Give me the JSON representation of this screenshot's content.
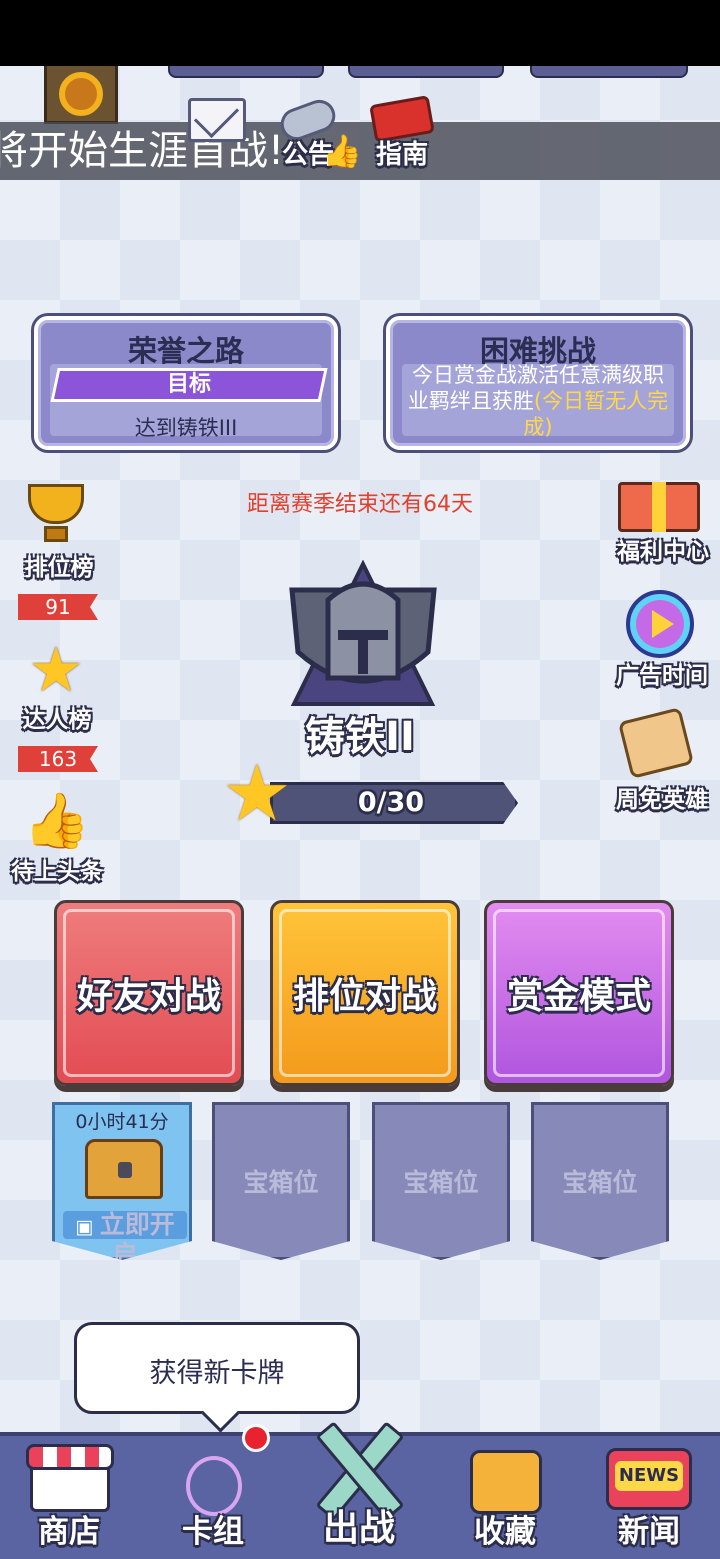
{
  "marquee": {
    "text": "将开始生涯首战!"
  },
  "top_icons": {
    "notice_label": "公告",
    "guide_label": "指南"
  },
  "honor_road": {
    "title": "荣誉之路",
    "goal_label": "目标",
    "requirement": "达到铸铁III"
  },
  "hard_challenge": {
    "title": "困难挑战",
    "desc": "今日赏金战激活任意满级职业羁绊且获胜",
    "status": "(今日暂无人完成)"
  },
  "season": {
    "countdown": "距离赛季结束还有64天"
  },
  "left_side": {
    "leaderboard": {
      "label": "排位榜",
      "badge": "91"
    },
    "experts": {
      "label": "达人榜",
      "badge": "163"
    },
    "headline": {
      "label": "待上头条"
    }
  },
  "right_side": {
    "welfare": "福利中心",
    "ad_time": "广告时间",
    "free_heroes": "周免英雄"
  },
  "rank": {
    "name": "铸铁II",
    "stars": "0/30"
  },
  "modes": {
    "friend": "好友对战",
    "ranked": "排位对战",
    "bounty": "赏金模式"
  },
  "chests": {
    "active": {
      "timer": "0小时41分",
      "action": "立即开启"
    },
    "empty_label": "宝箱位"
  },
  "tooltip": {
    "text": "获得新卡牌"
  },
  "nav": {
    "shop": "商店",
    "deck": "卡组",
    "battle": "出战",
    "collect": "收藏",
    "news": "新闻",
    "news_badge": "NEWS"
  },
  "colors": {
    "accent_red": "#e0402c",
    "bounty_purple": "#b055de",
    "ranked_orange": "#f49a1c",
    "friend_red": "#e24c53"
  }
}
